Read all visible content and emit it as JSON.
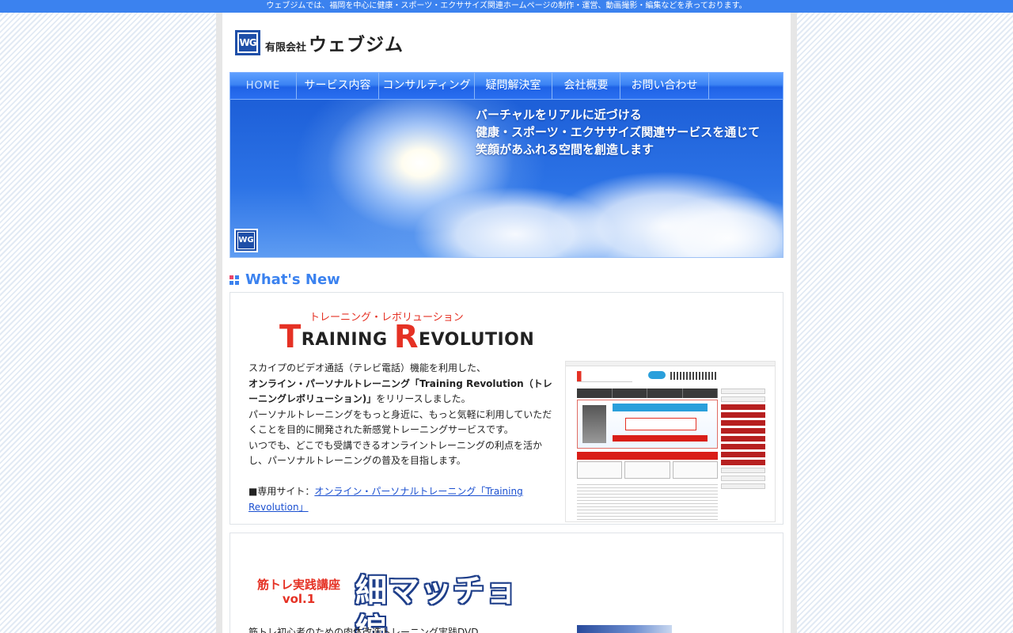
{
  "topbar": {
    "text": "ウェブジムでは、福岡を中心に健康・スポーツ・エクササイズ関連ホームページの制作・運営、動画撮影・編集などを承っております。"
  },
  "header": {
    "logo_mark": "WG",
    "company_prefix": "有限会社",
    "company_name": "ウェブジム"
  },
  "nav": {
    "items": [
      {
        "label": "HOME"
      },
      {
        "label": "サービス内容"
      },
      {
        "label": "コンサルティング"
      },
      {
        "label": "疑問解決室"
      },
      {
        "label": "会社概要"
      },
      {
        "label": "お問い合わせ"
      }
    ]
  },
  "hero": {
    "lines": [
      "バーチャルをリアルに近づける",
      "健康・スポーツ・エクササイズ関連サービスを通じて",
      "笑顔があふれる空間を創造します"
    ],
    "mark": "WG"
  },
  "whats_new": {
    "title": "What's New",
    "icon_colors": [
      "#e8456b",
      "#3b82ef",
      "#3b82ef",
      "#3b82ef"
    ]
  },
  "entry1": {
    "logo_kana": "トレーニング・レボリューション",
    "logo_t": "T",
    "logo_raining": "RAINING ",
    "logo_r": "R",
    "logo_evolution": "EVOLUTION",
    "p1": "スカイプのビデオ通話（テレビ電話）機能を利用した、",
    "p2_bold": "オンライン・パーソナルトレーニング「Training Revolution（トレーニングレボリューション)」",
    "p2_rest": "をリリースしました。",
    "p3": "パーソナルトレーニングをもっと身近に、もっと気軽に利用していただくことを目的に開発された新感覚トレーニングサービスです。",
    "p4": "いつでも、どこでも受講できるオンライントレーニングの利点を活かし、パーソナルトレーニングの普及を目指します。",
    "site_prefix": "■専用サイト：",
    "site_link": "オンライン・パーソナルトレーニング「Training Revolution」",
    "thumb_alt": "Training Revolution site screenshot"
  },
  "entry2": {
    "logo_left_1": "筋トレ実践講座",
    "logo_left_2": "vol.1",
    "logo_right": "細マッチョ編",
    "desc": "筋トレ初心者のための肉体改造トレーニング実践DVD"
  },
  "colors": {
    "accent": "#3b82ef",
    "nav_blue": "#2a6ff0",
    "brand_red": "#e53124",
    "link": "#1a4fd0"
  }
}
